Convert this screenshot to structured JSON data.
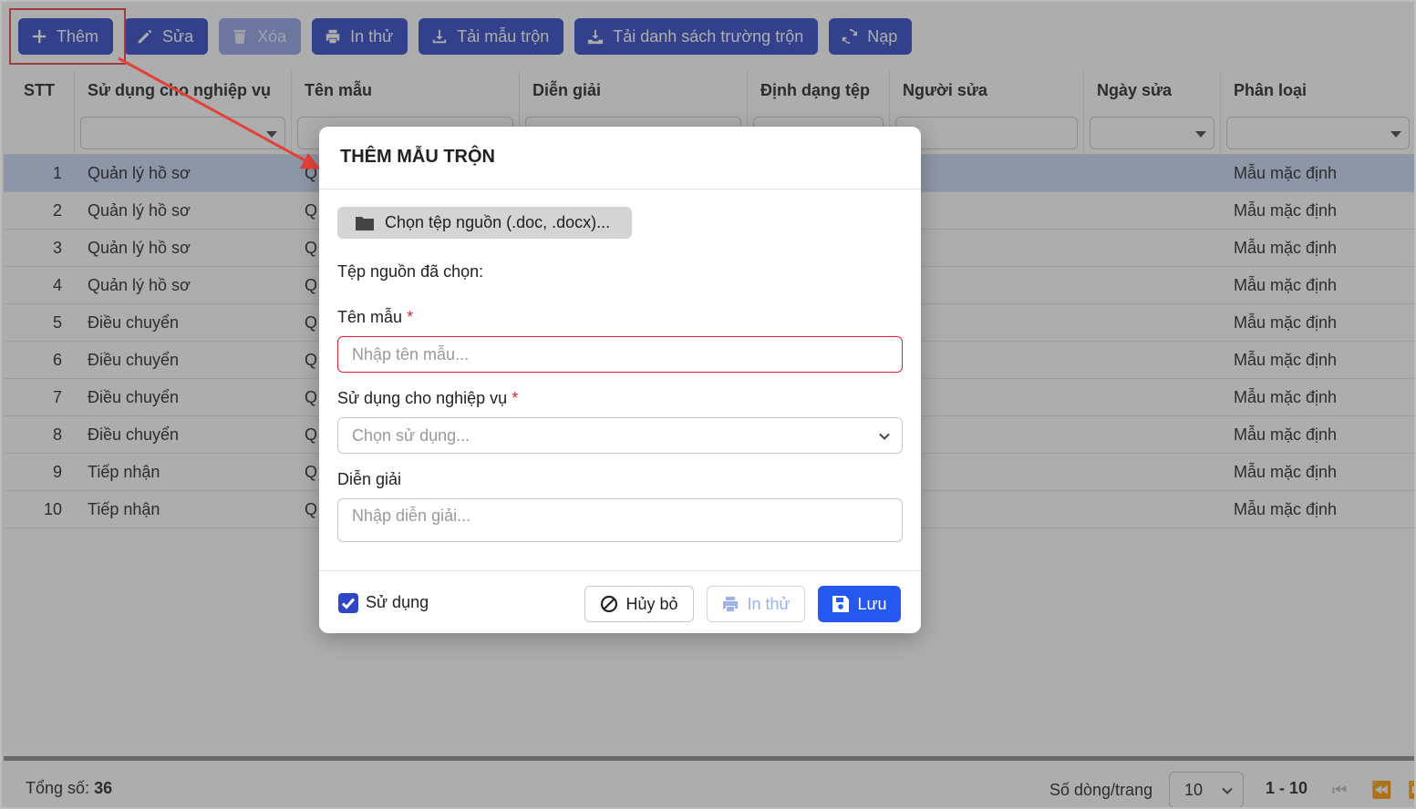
{
  "toolbar": {
    "add_label": "Thêm",
    "edit_label": "Sửa",
    "delete_label": "Xóa",
    "print_label": "In thử",
    "download_template_label": "Tải mẫu trộn",
    "download_fields_label": "Tải danh sách trường trộn",
    "reload_label": "Nạp"
  },
  "grid": {
    "columns": [
      "STT",
      "Sử dụng cho nghiệp vụ",
      "Tên mẫu",
      "Diễn giải",
      "Định dạng tệp",
      "Người sửa",
      "Ngày sửa",
      "Phân loại"
    ],
    "rows": [
      {
        "stt": "1",
        "su_dung": "Quản lý hồ sơ",
        "ten_mau": "Q",
        "phan_loai": "Mẫu mặc định"
      },
      {
        "stt": "2",
        "su_dung": "Quản lý hồ sơ",
        "ten_mau": "Q",
        "phan_loai": "Mẫu mặc định"
      },
      {
        "stt": "3",
        "su_dung": "Quản lý hồ sơ",
        "ten_mau": "Q",
        "phan_loai": "Mẫu mặc định"
      },
      {
        "stt": "4",
        "su_dung": "Quản lý hồ sơ",
        "ten_mau": "Q",
        "phan_loai": "Mẫu mặc định"
      },
      {
        "stt": "5",
        "su_dung": "Điều chuyển",
        "ten_mau": "Q",
        "phan_loai": "Mẫu mặc định"
      },
      {
        "stt": "6",
        "su_dung": "Điều chuyển",
        "ten_mau": "Q",
        "phan_loai": "Mẫu mặc định"
      },
      {
        "stt": "7",
        "su_dung": "Điều chuyển",
        "ten_mau": "Q",
        "phan_loai": "Mẫu mặc định"
      },
      {
        "stt": "8",
        "su_dung": "Điều chuyển",
        "ten_mau": "Q",
        "phan_loai": "Mẫu mặc định"
      },
      {
        "stt": "9",
        "su_dung": "Tiếp nhận",
        "ten_mau": "Q",
        "phan_loai": "Mẫu mặc định"
      },
      {
        "stt": "10",
        "su_dung": "Tiếp nhận",
        "ten_mau": "Q",
        "phan_loai": "Mẫu mặc định"
      }
    ],
    "selected_row": 1
  },
  "footer": {
    "total_label": "Tổng số:",
    "total_value": "36",
    "rows_per_page_label": "Số dòng/trang",
    "rows_per_page_value": "10",
    "range": "1 - 10"
  },
  "modal": {
    "title": "THÊM MẪU TRỘN",
    "choose_file_label": "Chọn tệp nguồn (.doc, .docx)...",
    "selected_file_label": "Tệp nguồn đã chọn:",
    "name_label": "Tên mẫu",
    "name_placeholder": "Nhập tên mẫu...",
    "usage_label": "Sử dụng cho nghiệp vụ",
    "usage_placeholder": "Chọn sử dụng...",
    "description_label": "Diễn giải",
    "description_placeholder": "Nhập diễn giải...",
    "required_mark": "*",
    "use_checkbox_label": "Sử dụng",
    "use_checked": true,
    "cancel_label": "Hủy bỏ",
    "print_label": "In thử",
    "save_label": "Lưu"
  },
  "colors": {
    "primary": "#2e45c8",
    "save": "#2458ef",
    "error": "#d9262f",
    "annotation": "#e4413a",
    "selected_row": "#c9d7f4"
  }
}
